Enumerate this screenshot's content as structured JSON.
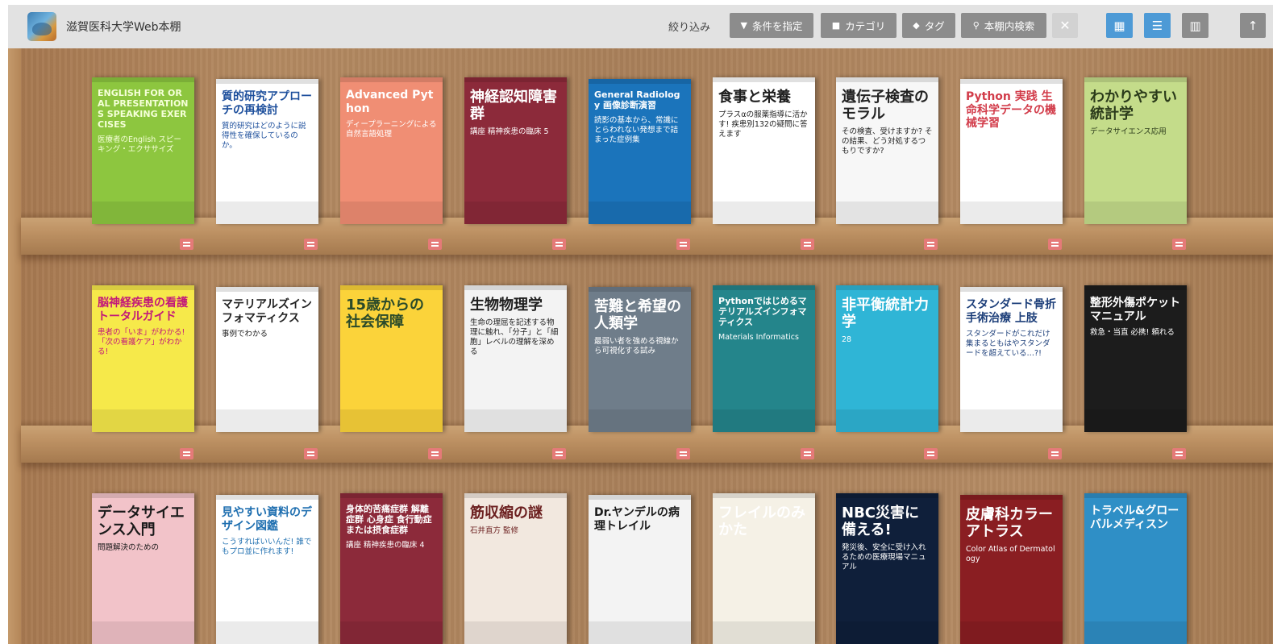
{
  "header": {
    "site_title": "滋賀医科大学Web本棚",
    "filter_label": "絞り込み",
    "buttons": {
      "conditions": "条件を指定",
      "category": "カテゴリ",
      "tag": "タグ",
      "search": "本棚内検索"
    },
    "icons": {
      "conditions": "filter-icon",
      "category": "folder-icon",
      "tag": "tag-icon",
      "search": "search-icon",
      "clear": "close-icon",
      "grid_view": "grid-view-icon",
      "list_view": "list-view-icon",
      "masonry_view": "masonry-view-icon",
      "top": "arrow-up-icon"
    },
    "colors": {
      "active_view": "#4d9ad6",
      "inactive": "#8c8c8c",
      "disabled": "#d2d2d2"
    }
  },
  "shelves": [
    {
      "books": [
        {
          "title": "ENGLISH FOR ORAL PRESENTATIONS SPEAKING EXERCISES",
          "subtitle": "医療者のEnglish スピーキング・エクササイズ",
          "bg": "#8dc63f",
          "fg": "#f5ffd8"
        },
        {
          "title": "質的研究アプローチの再検討",
          "subtitle": "質的研究はどのように説得性を確保しているのか。",
          "bg": "#ffffff",
          "fg": "#1d4f9c"
        },
        {
          "title": "Advanced Python",
          "subtitle": "ディープラーニングによる自然言語処理",
          "bg": "#f08e74",
          "fg": "#ffffff"
        },
        {
          "title": "神経認知障害群",
          "subtitle": "講座 精神疾患の臨床 5",
          "bg": "#8c2a3a",
          "fg": "#ffffff"
        },
        {
          "title": "General Radiology 画像診断演習",
          "subtitle": "読影の基本から、常識にとらわれない発想まで詰まった症例集",
          "bg": "#1b74bb",
          "fg": "#ffffff"
        },
        {
          "title": "食事と栄養",
          "subtitle": "プラスαの服薬指導に活かす! 疾患別132の疑問に答えます",
          "bg": "#ffffff",
          "fg": "#1e1e1e"
        },
        {
          "title": "遺伝子検査のモラル",
          "subtitle": "その検査、受けますか? その結果、どう対処するつもりですか?",
          "bg": "#f7f7f7",
          "fg": "#222222"
        },
        {
          "title": "Python 実践 生命科学データの機械学習",
          "subtitle": "",
          "bg": "#ffffff",
          "fg": "#d23c4a"
        },
        {
          "title": "わかりやすい統計学",
          "subtitle": "データサイエンス応用",
          "bg": "#c4dc8a",
          "fg": "#2a3a1a"
        }
      ]
    },
    {
      "books": [
        {
          "title": "脳神経疾患の看護トータルガイド",
          "subtitle": "患者の「いま」がわかる! 「次の看護ケア」がわかる!",
          "bg": "#f6e94a",
          "fg": "#c2187a"
        },
        {
          "title": "マテリアルズインフォマティクス",
          "subtitle": "事例でわかる",
          "bg": "#ffffff",
          "fg": "#222222"
        },
        {
          "title": "15歳からの社会保障",
          "subtitle": "",
          "bg": "#fbd33a",
          "fg": "#2a4a2a"
        },
        {
          "title": "生物物理学",
          "subtitle": "生命の理屈を記述する物理に触れ、「分子」と「細胞」レベルの理解を深める",
          "bg": "#f3f3f3",
          "fg": "#1e1e1e"
        },
        {
          "title": "苦難と希望の人類学",
          "subtitle": "最弱い者を強める視線から可視化する試み",
          "bg": "#6f7d8a",
          "fg": "#ffffff"
        },
        {
          "title": "Pythonではじめるマテリアルズインフォマティクス",
          "subtitle": "Materials Informatics",
          "bg": "#24858b",
          "fg": "#ffffff"
        },
        {
          "title": "非平衡統計力学",
          "subtitle": "28",
          "bg": "#2fb5d6",
          "fg": "#ffffff"
        },
        {
          "title": "スタンダード骨折手術治療 上肢",
          "subtitle": "スタンダードがこれだけ集まるともはやスタンダードを超えている…?!",
          "bg": "#ffffff",
          "fg": "#1d3f7a"
        },
        {
          "title": "整形外傷ポケットマニュアル",
          "subtitle": "救急・当直 必携! 頼れる",
          "bg": "#1c1c1c",
          "fg": "#ffffff"
        }
      ]
    },
    {
      "books": [
        {
          "title": "データサイエンス入門",
          "subtitle": "問題解決のための",
          "bg": "#f2c3c9",
          "fg": "#1a1a1a"
        },
        {
          "title": "見やすい資料のデザイン図鑑",
          "subtitle": "こうすればいいんだ! 誰でもプロ並に作れます!",
          "bg": "#ffffff",
          "fg": "#1f6fb0"
        },
        {
          "title": "身体的苦痛症群 解離症群 心身症 食行動症または摂食症群",
          "subtitle": "講座 精神疾患の臨床 4",
          "bg": "#8c2a3a",
          "fg": "#ffffff"
        },
        {
          "title": "筋収縮の謎",
          "subtitle": "石井直方 監修",
          "bg": "#f2e8df",
          "fg": "#6b1f1f"
        },
        {
          "title": "Dr.ヤンデルの病理トレイル",
          "subtitle": "",
          "bg": "#f3f3f3",
          "fg": "#1a1a1a"
        },
        {
          "title": "フレイルのみかた",
          "subtitle": "",
          "bg": "#f5f1e6",
          "fg": "#ffffff"
        },
        {
          "title": "NBC災害に備える!",
          "subtitle": "発災後、安全に受け入れるための医療現場マニュアル",
          "bg": "#0f1f3a",
          "fg": "#ffffff"
        },
        {
          "title": "皮膚科カラーアトラス",
          "subtitle": "Color Atlas of Dermatology",
          "bg": "#8a1e22",
          "fg": "#ffffff"
        },
        {
          "title": "トラベル&グローバルメディスン",
          "subtitle": "",
          "bg": "#2f8fc6",
          "fg": "#ffffff"
        }
      ]
    }
  ]
}
